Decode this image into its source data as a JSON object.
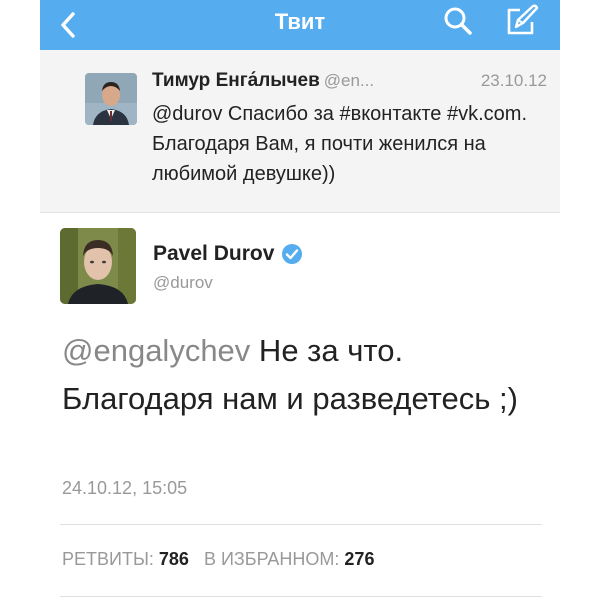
{
  "navbar": {
    "title": "Твит",
    "back_icon": "chevron-left-icon",
    "search_icon": "search-icon",
    "compose_icon": "compose-icon",
    "background": "#55acee"
  },
  "reply_to": {
    "name": "Тимур Енга́лычев",
    "handle": "@en...",
    "date": "23.10.12",
    "text": "@durov Спасибо за #вконтакте #vk.com. Благодаря Вам, я почти женился на любимой девушке))"
  },
  "tweet": {
    "name": "Pavel Durov",
    "handle": "@durov",
    "verified": true,
    "mention": "@engalychev",
    "text_rest": " Не за что. Благодаря нам и разведетесь ;)",
    "timestamp": "24.10.12, 15:05"
  },
  "stats": {
    "retweets_label": "РЕТВИТЫ:",
    "retweets_value": "786",
    "favorites_label": "В ИЗБРАННОМ:",
    "favorites_value": "276"
  }
}
